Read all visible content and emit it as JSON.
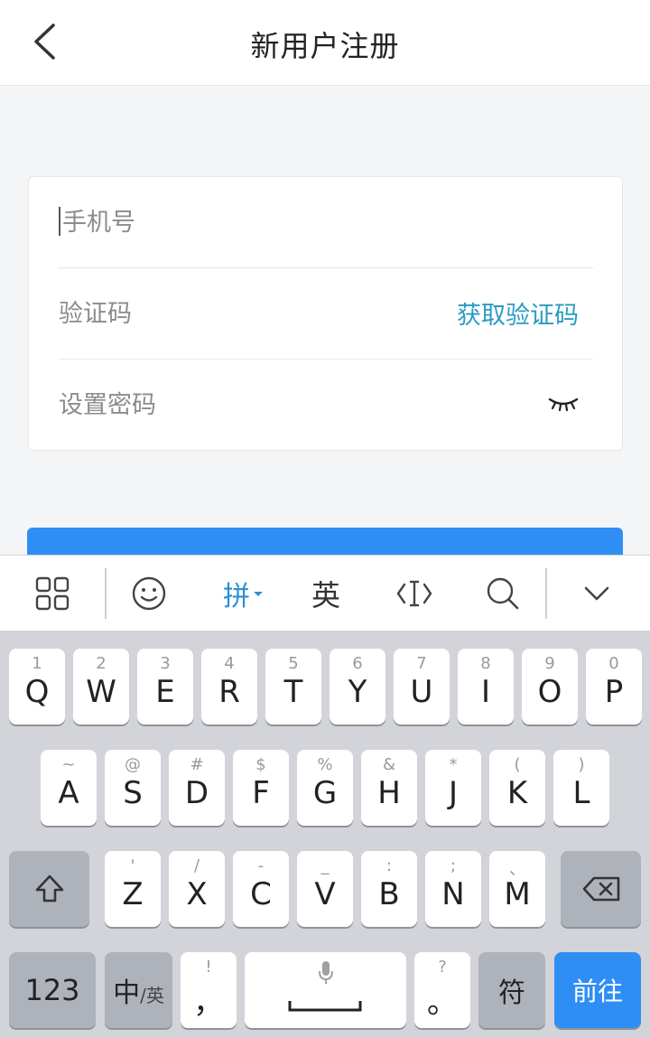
{
  "header": {
    "title": "新用户注册"
  },
  "form": {
    "phone_placeholder": "手机号",
    "code_placeholder": "验证码",
    "get_code_label": "获取验证码",
    "password_placeholder": "设置密码"
  },
  "keyboard": {
    "toolbar": {
      "pinyin_label": "拼",
      "english_label": "英"
    },
    "row1": [
      {
        "sub": "1",
        "main": "Q"
      },
      {
        "sub": "2",
        "main": "W"
      },
      {
        "sub": "3",
        "main": "E"
      },
      {
        "sub": "4",
        "main": "R"
      },
      {
        "sub": "5",
        "main": "T"
      },
      {
        "sub": "6",
        "main": "Y"
      },
      {
        "sub": "7",
        "main": "U"
      },
      {
        "sub": "8",
        "main": "I"
      },
      {
        "sub": "9",
        "main": "O"
      },
      {
        "sub": "0",
        "main": "P"
      }
    ],
    "row2": [
      {
        "sub": "~",
        "main": "A"
      },
      {
        "sub": "@",
        "main": "S"
      },
      {
        "sub": "#",
        "main": "D"
      },
      {
        "sub": "$",
        "main": "F"
      },
      {
        "sub": "%",
        "main": "G"
      },
      {
        "sub": "&",
        "main": "H"
      },
      {
        "sub": "*",
        "main": "J"
      },
      {
        "sub": "(",
        "main": "K"
      },
      {
        "sub": ")",
        "main": "L"
      }
    ],
    "row3": [
      {
        "sub": "'",
        "main": "Z"
      },
      {
        "sub": "/",
        "main": "X"
      },
      {
        "sub": "-",
        "main": "C"
      },
      {
        "sub": "_",
        "main": "V"
      },
      {
        "sub": ":",
        "main": "B"
      },
      {
        "sub": ";",
        "main": "N"
      },
      {
        "sub": "、",
        "main": "M"
      }
    ],
    "num_label": "123",
    "lang_main": "中",
    "lang_sub": "/英",
    "comma_sub": "!",
    "comma_main": "，",
    "period_sub": "?",
    "period_main": "。",
    "symbol_label": "符",
    "go_label": "前往"
  }
}
